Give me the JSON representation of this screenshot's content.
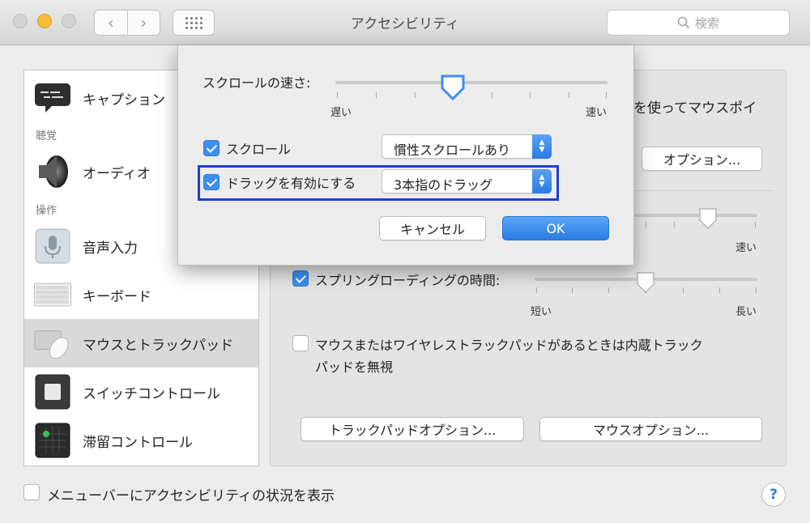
{
  "window": {
    "title": "アクセシビリティ",
    "search_placeholder": "検索"
  },
  "sidebar": {
    "items": [
      {
        "label": "キャプション",
        "icon": "captions-icon"
      },
      {
        "label": "オーディオ",
        "icon": "speaker-icon"
      },
      {
        "label": "音声入力",
        "icon": "microphone-icon"
      },
      {
        "label": "キーボード",
        "icon": "keyboard-icon"
      },
      {
        "label": "マウスとトラックパッド",
        "icon": "mouse-trackpad-icon",
        "selected": true
      },
      {
        "label": "スイッチコントロール",
        "icon": "switch-control-icon"
      },
      {
        "label": "滞留コントロール",
        "icon": "dwell-control-icon"
      }
    ],
    "headers": [
      "聴覚",
      "操作"
    ]
  },
  "panel": {
    "partial_text": "を使ってマウスポイ",
    "options_button": "オプション...",
    "fast_label": "速い",
    "spring_loading_label": "スプリングローディングの時間:",
    "spring_short": "短い",
    "spring_long": "長い",
    "ignore_trackpad_line1": "マウスまたはワイヤレストラックパッドがあるときは内蔵トラック",
    "ignore_trackpad_line2": "パッドを無視",
    "trackpad_options_button": "トラックパッドオプション...",
    "mouse_options_button": "マウスオプション..."
  },
  "bottom": {
    "show_status_label": "メニューバーにアクセシビリティの状況を表示",
    "help": "?"
  },
  "sheet": {
    "scroll_speed_label": "スクロールの速さ:",
    "slow_label": "遅い",
    "fast_label": "速い",
    "scroll_label": "スクロール",
    "scroll_popup": "慣性スクロールあり",
    "drag_label": "ドラッグを有効にする",
    "drag_popup": "3本指のドラッグ",
    "cancel_button": "キャンセル",
    "ok_button": "OK"
  },
  "colors": {
    "accent": "#3d8ff0",
    "highlight_border": "#1b3fd8"
  }
}
